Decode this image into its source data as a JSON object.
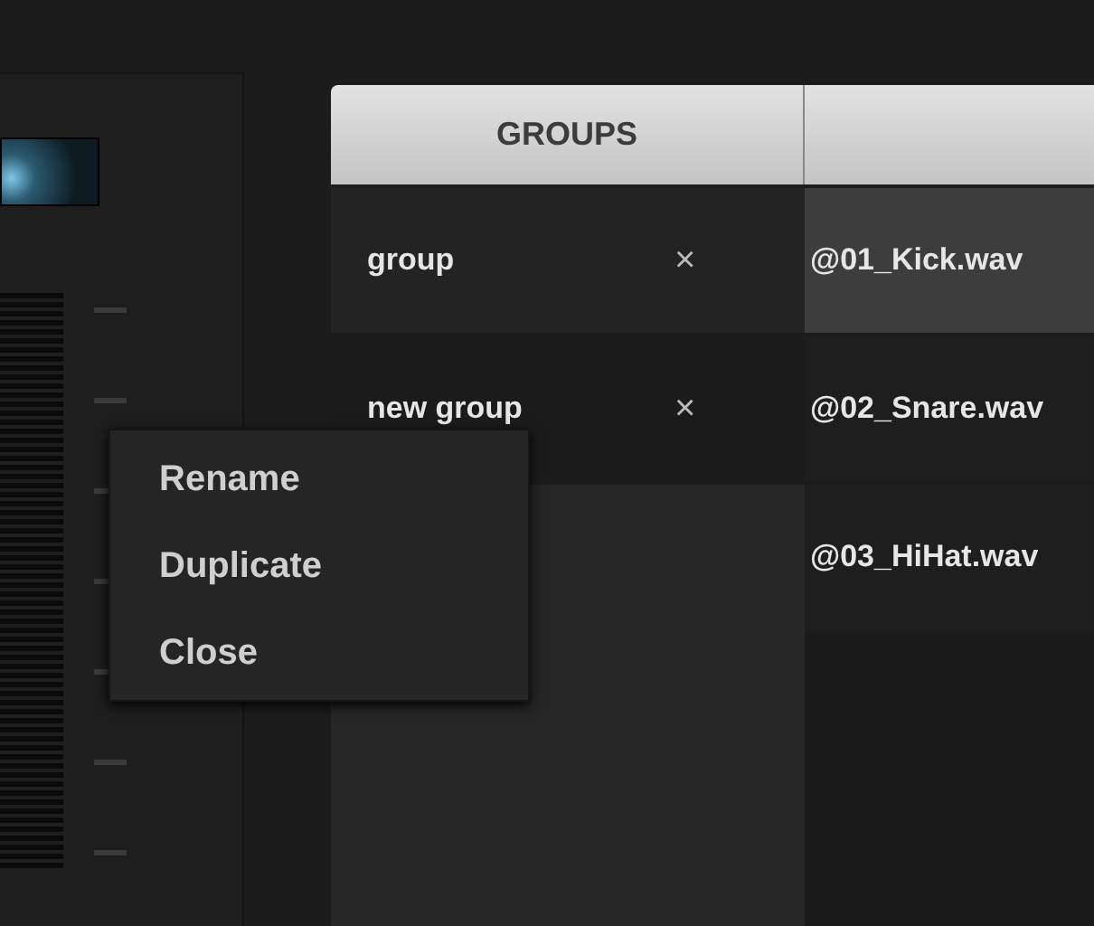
{
  "groups": {
    "header": "GROUPS",
    "items": [
      {
        "name": "group",
        "close": "×"
      },
      {
        "name": "new group",
        "close": "×"
      }
    ]
  },
  "samples": {
    "items": [
      {
        "name": "@01_Kick.wav",
        "selected": true
      },
      {
        "name": "@02_Snare.wav",
        "selected": false
      },
      {
        "name": "@03_HiHat.wav",
        "selected": false
      }
    ]
  },
  "context_menu": {
    "items": [
      "Rename",
      "Duplicate",
      "Close"
    ]
  }
}
